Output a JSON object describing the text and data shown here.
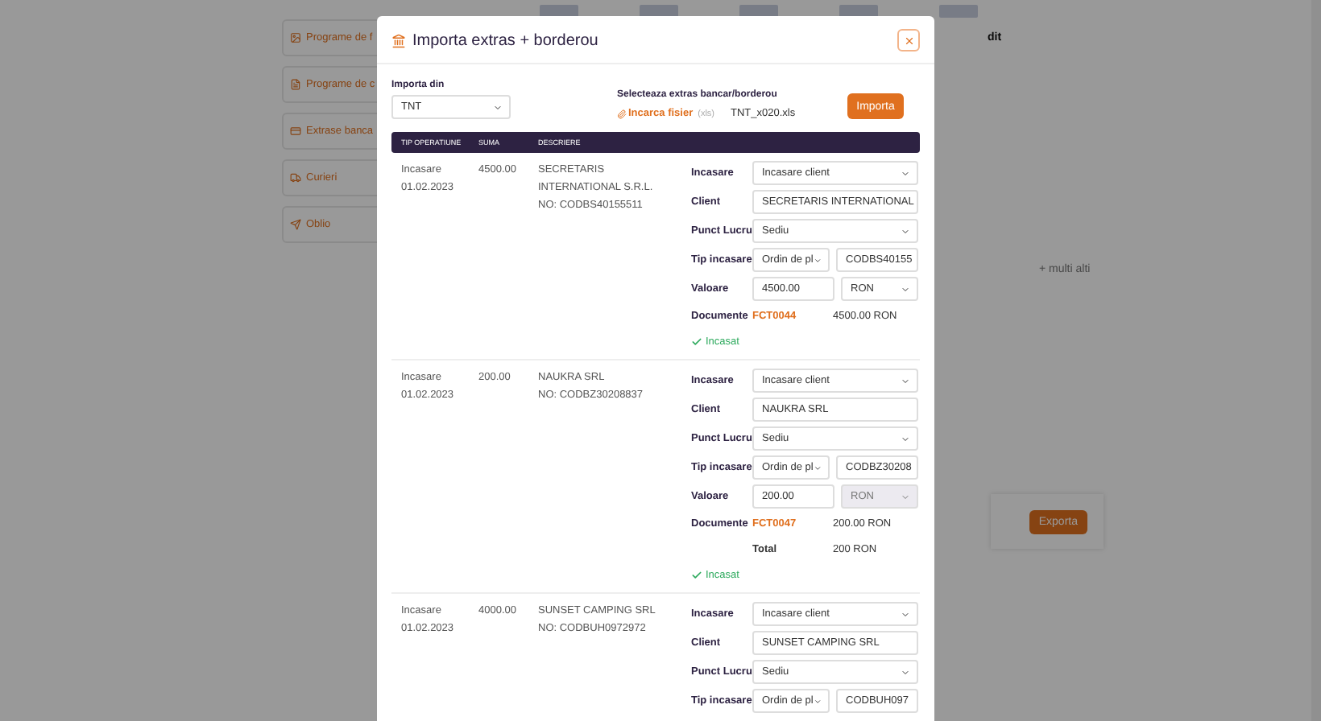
{
  "sidebar": {
    "items": [
      {
        "label": "Programe de f"
      },
      {
        "label": "Programe de c"
      },
      {
        "label": "Extrase banca"
      },
      {
        "label": "Curieri"
      },
      {
        "label": "Oblio"
      }
    ]
  },
  "background": {
    "heading": "dit",
    "more_banks": "+ multi alti",
    "export_button": "Exporta"
  },
  "modal": {
    "title": "Importa extras + borderou",
    "import_from": {
      "label": "Importa din",
      "value": "TNT"
    },
    "file": {
      "label": "Selecteaza extras bancar/borderou",
      "upload_link": "Incarca fisier",
      "upload_hint": "(xls)",
      "file_name": "TNT_x020.xls"
    },
    "import_button": "Importa",
    "table": {
      "columns": [
        "TIP OPERATIUNE",
        "SUMA",
        "DESCRIERE"
      ],
      "rows": [
        {
          "type": "Incasare",
          "date": "01.02.2023",
          "amount": "4500.00",
          "description": [
            "SECRETARIS",
            "INTERNATIONAL S.R.L.",
            "NO: CODBS40155511"
          ],
          "fields": [
            {
              "label": "Incasare",
              "controls": [
                {
                  "kind": "select",
                  "value": "Incasare client",
                  "disabled": false
                }
              ]
            },
            {
              "label": "Client",
              "controls": [
                {
                  "kind": "input",
                  "value": "SECRETARIS INTERNATIONAL"
                }
              ]
            },
            {
              "label": "Punct Lucru",
              "controls": [
                {
                  "kind": "select",
                  "value": "Sediu",
                  "disabled": false
                }
              ]
            },
            {
              "label": "Tip incasare",
              "controls": [
                {
                  "kind": "select",
                  "value": "Ordin de pl",
                  "disabled": false
                },
                {
                  "kind": "input",
                  "value": "CODBS40155"
                }
              ]
            },
            {
              "label": "Valoare",
              "controls": [
                {
                  "kind": "input",
                  "value": "4500.00"
                },
                {
                  "kind": "select",
                  "value": "RON",
                  "disabled": false
                }
              ]
            }
          ],
          "documents_label": "Documente",
          "documents": [
            {
              "number": "FCT0044",
              "amount": "4500.00 RON"
            }
          ],
          "status": "Incasat"
        },
        {
          "type": "Incasare",
          "date": "01.02.2023",
          "amount": "200.00",
          "description": [
            "NAUKRA SRL",
            "NO: CODBZ30208837"
          ],
          "fields": [
            {
              "label": "Incasare",
              "controls": [
                {
                  "kind": "select",
                  "value": "Incasare client",
                  "disabled": false
                }
              ]
            },
            {
              "label": "Client",
              "controls": [
                {
                  "kind": "input",
                  "value": "NAUKRA SRL"
                }
              ]
            },
            {
              "label": "Punct Lucru",
              "controls": [
                {
                  "kind": "select",
                  "value": "Sediu",
                  "disabled": false
                }
              ]
            },
            {
              "label": "Tip incasare",
              "controls": [
                {
                  "kind": "select",
                  "value": "Ordin de pl",
                  "disabled": false
                },
                {
                  "kind": "input",
                  "value": "CODBZ30208"
                }
              ]
            },
            {
              "label": "Valoare",
              "controls": [
                {
                  "kind": "input",
                  "value": "200.00"
                },
                {
                  "kind": "select",
                  "value": "RON",
                  "disabled": true
                }
              ]
            }
          ],
          "documents_label": "Documente",
          "documents": [
            {
              "number": "FCT0047",
              "amount": "200.00 RON"
            }
          ],
          "total": {
            "label": "Total",
            "value": "200 RON"
          },
          "status": "Incasat"
        },
        {
          "type": "Incasare",
          "date": "01.02.2023",
          "amount": "4000.00",
          "description": [
            "SUNSET CAMPING SRL",
            "NO: CODBUH0972972"
          ],
          "fields": [
            {
              "label": "Incasare",
              "controls": [
                {
                  "kind": "select",
                  "value": "Incasare client",
                  "disabled": false
                }
              ]
            },
            {
              "label": "Client",
              "controls": [
                {
                  "kind": "input",
                  "value": "SUNSET CAMPING SRL"
                }
              ]
            },
            {
              "label": "Punct Lucru",
              "controls": [
                {
                  "kind": "select",
                  "value": "Sediu",
                  "disabled": false
                }
              ]
            },
            {
              "label": "Tip incasare",
              "controls": [
                {
                  "kind": "select",
                  "value": "Ordin de pl",
                  "disabled": false
                },
                {
                  "kind": "input",
                  "value": "CODBUH097"
                }
              ]
            }
          ]
        }
      ]
    }
  }
}
